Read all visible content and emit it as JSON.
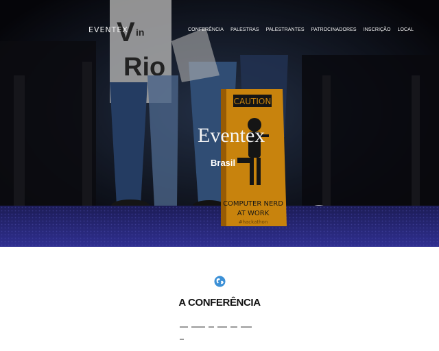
{
  "brand": "EVENTEX",
  "nav": {
    "items": [
      "CONFERÊNCIA",
      "PALESTRAS",
      "PALESTRANTES",
      "PATROCINADORES",
      "INSCRIÇÃO",
      "LOCAL"
    ]
  },
  "hero": {
    "title": "Eventex",
    "subtitle": "Brasil",
    "sign_top": "CAUTION",
    "sign_bottom_1": "COMPUTER NERD",
    "sign_bottom_2": "AT WORK",
    "sign_bottom_3": "#hackathon",
    "banner_text": "V in Rio"
  },
  "section": {
    "title": "A CONFERÊNCIA",
    "icon": "globe-icon"
  },
  "colors": {
    "accent_blue": "#3c90d6",
    "sign_orange": "#f4a010",
    "carpet_blue": "#3a3aa0"
  }
}
